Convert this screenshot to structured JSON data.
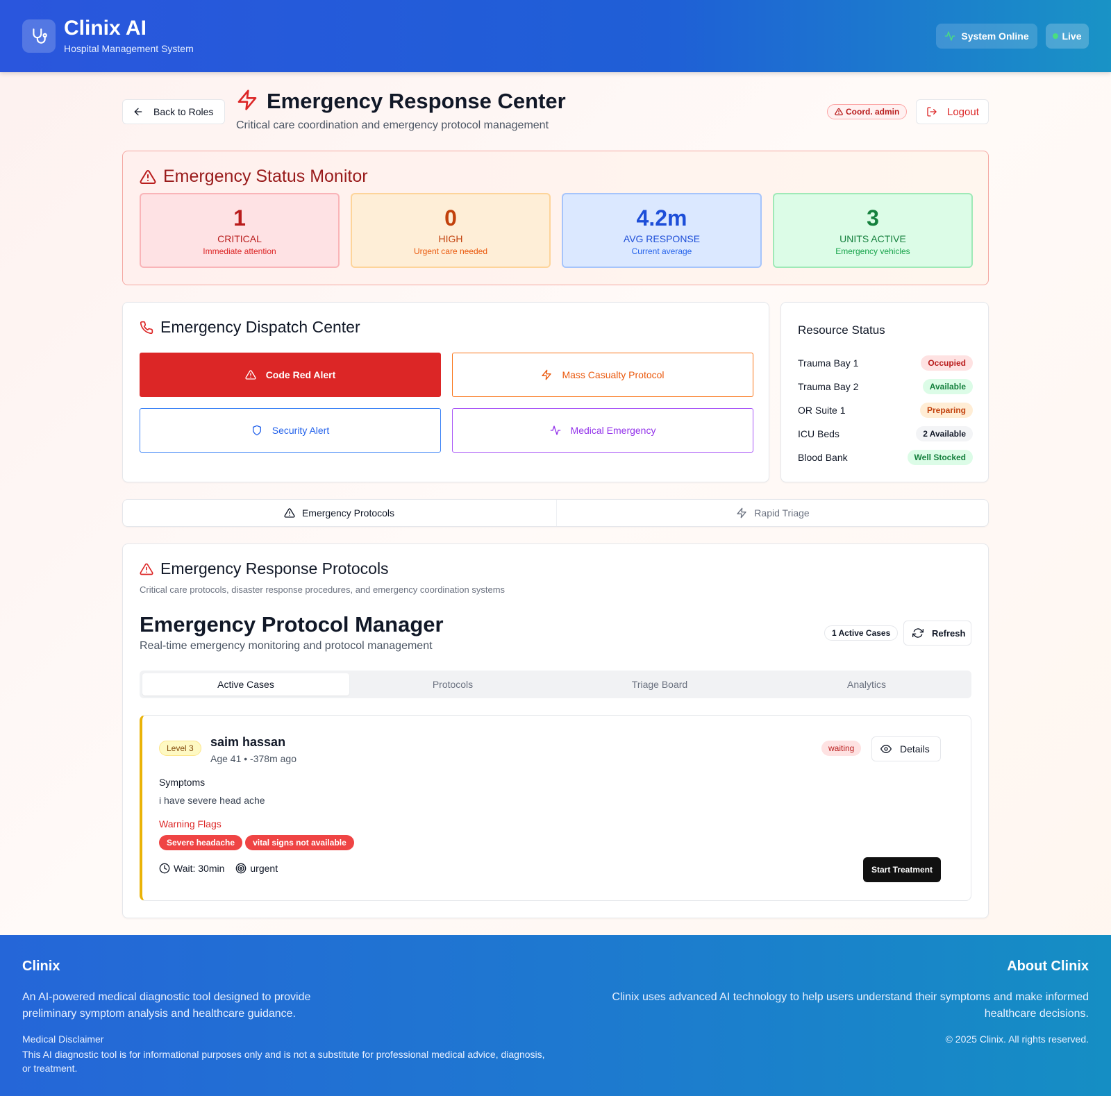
{
  "header": {
    "app_name": "Clinix AI",
    "app_subtitle": "Hospital Management System",
    "logo_icon": "stethoscope-icon",
    "system_status": "System Online",
    "live_label": "Live"
  },
  "page": {
    "back_label": "Back to Roles",
    "title": "Emergency Response Center",
    "subtitle": "Critical care coordination and emergency protocol management",
    "role_badge": "Coord. admin",
    "logout_label": "Logout"
  },
  "status_monitor": {
    "title": "Emergency Status Monitor",
    "cards": [
      {
        "value": "1",
        "label": "CRITICAL",
        "note": "Immediate attention",
        "color": "#b91c1c"
      },
      {
        "value": "0",
        "label": "HIGH",
        "note": "Urgent care needed",
        "color": "#c2410c"
      },
      {
        "value": "4.2m",
        "label": "AVG RESPONSE",
        "note": "Current average",
        "color": "#1d4ed8"
      },
      {
        "value": "3",
        "label": "UNITS ACTIVE",
        "note": "Emergency vehicles",
        "color": "#15803d"
      }
    ]
  },
  "dispatch": {
    "title": "Emergency Dispatch Center",
    "buttons": [
      {
        "label": "Code Red Alert",
        "icon": "alert-triangle-icon"
      },
      {
        "label": "Mass Casualty Protocol",
        "icon": "zap-icon"
      },
      {
        "label": "Security Alert",
        "icon": "shield-icon"
      },
      {
        "label": "Medical Emergency",
        "icon": "activity-icon"
      }
    ]
  },
  "resources": {
    "title": "Resource Status",
    "items": [
      {
        "name": "Trauma Bay 1",
        "status": "Occupied"
      },
      {
        "name": "Trauma Bay 2",
        "status": "Available"
      },
      {
        "name": "OR Suite 1",
        "status": "Preparing"
      },
      {
        "name": "ICU Beds",
        "status": "2 Available"
      },
      {
        "name": "Blood Bank",
        "status": "Well Stocked"
      }
    ]
  },
  "main_tabs": [
    {
      "label": "Emergency Protocols",
      "active": true
    },
    {
      "label": "Rapid Triage",
      "active": false
    }
  ],
  "protocols": {
    "title": "Emergency Response Protocols",
    "subtitle": "Critical care protocols, disaster response procedures, and emergency coordination systems",
    "manager_title": "Emergency Protocol Manager",
    "manager_subtitle": "Real-time emergency monitoring and protocol management",
    "active_cases_badge": "1 Active Cases",
    "refresh_label": "Refresh",
    "tabs": [
      "Active Cases",
      "Protocols",
      "Triage Board",
      "Analytics"
    ],
    "case": {
      "level": "Level 3",
      "patient_name": "saim hassan",
      "meta": "Age 41 • -378m ago",
      "status": "waiting",
      "details_label": "Details",
      "symptoms_label": "Symptoms",
      "symptoms": "i have severe head ache",
      "warning_label": "Warning Flags",
      "flags": [
        "Severe headache",
        "vital signs not available"
      ],
      "wait": "Wait: 30min",
      "priority": "urgent",
      "start_label": "Start Treatment"
    }
  },
  "footer": {
    "brand": "Clinix",
    "description": "An AI-powered medical diagnostic tool designed to provide preliminary symptom analysis and healthcare guidance.",
    "disclaimer_title": "Medical Disclaimer",
    "disclaimer": "This AI diagnostic tool is for informational purposes only and is not a substitute for professional medical advice, diagnosis, or treatment.",
    "about_title": "About Clinix",
    "about_text": "Clinix uses advanced AI technology to help users understand their symptoms and make informed healthcare decisions.",
    "copyright": "© 2025 Clinix. All rights reserved."
  }
}
